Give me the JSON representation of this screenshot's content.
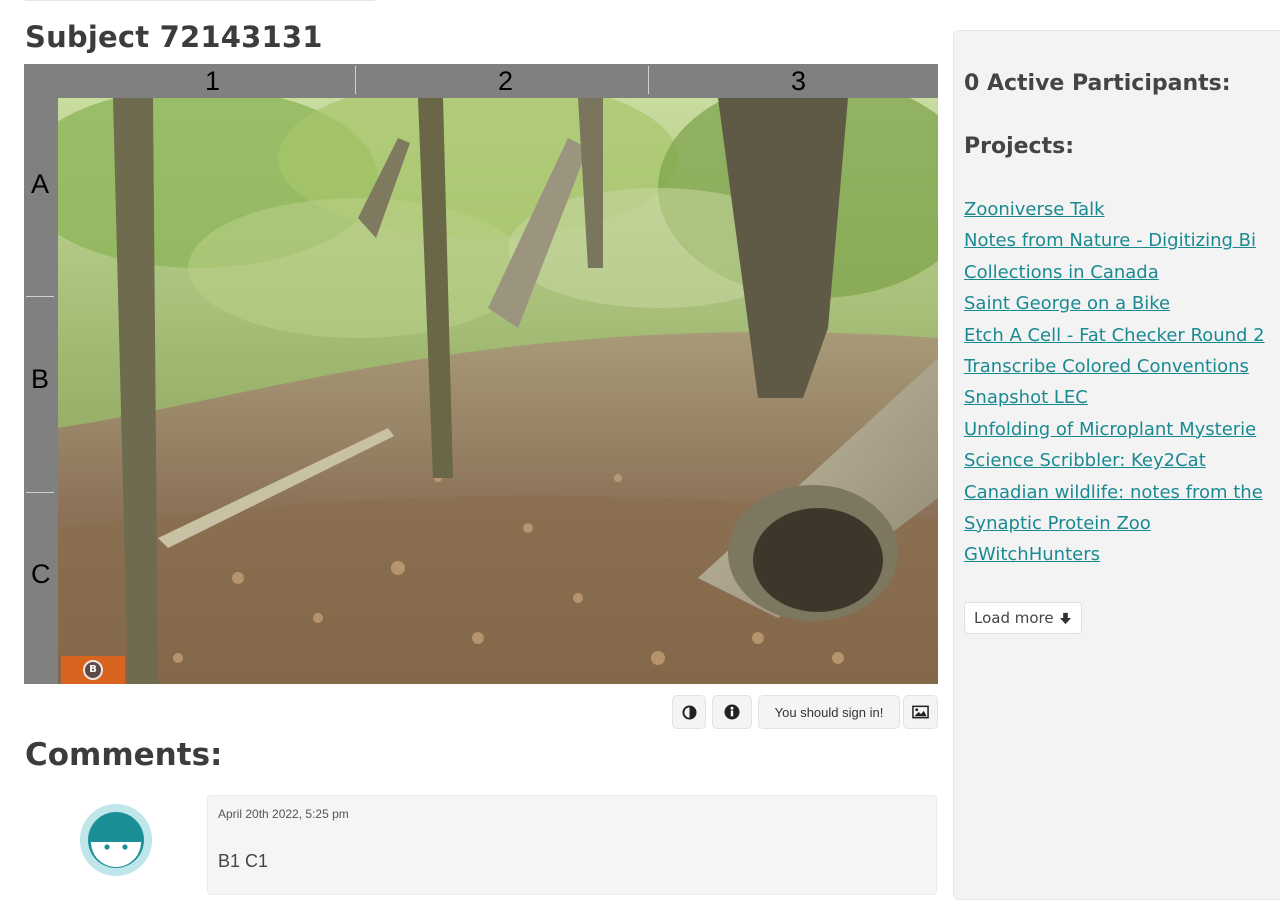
{
  "subject": {
    "title": "Subject 72143131"
  },
  "grid": {
    "columns": [
      "1",
      "2",
      "3"
    ],
    "rows": [
      "A",
      "B",
      "C"
    ]
  },
  "toolbar": {
    "contrast_icon": "half-circle-icon",
    "info_icon": "info-icon",
    "sign_in_label": "You should sign in!",
    "image_icon": "image-icon"
  },
  "comments": {
    "heading": "Comments:",
    "items": [
      {
        "date": "April 20th 2022, 5:25 pm",
        "body": "B1 C1"
      }
    ]
  },
  "sidebar": {
    "participants": "0 Active Participants:",
    "projects_heading": "Projects:",
    "projects": [
      "Zooniverse Talk",
      "Notes from Nature - Digitizing Bi",
      "Collections in Canada",
      "Saint George on a Bike ",
      "Etch A Cell - Fat Checker Round 2",
      "Transcribe Colored Conventions",
      "Snapshot LEC",
      "Unfolding of Microplant Mysterie",
      "Science Scribbler: Key2Cat",
      "Canadian wildlife: notes from the",
      "Synaptic Protein Zoo",
      "GWitchHunters"
    ],
    "load_more": "Load more"
  },
  "colors": {
    "link": "#1a8a92",
    "avatar": "#bfe6e9",
    "badge": "#d9641f"
  }
}
